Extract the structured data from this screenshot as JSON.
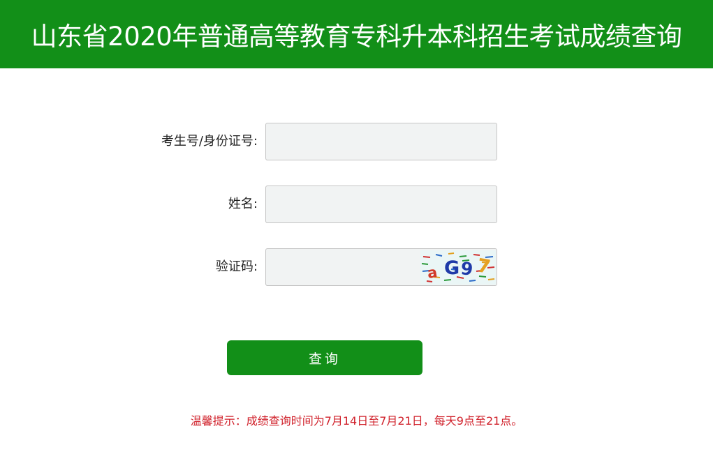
{
  "header": {
    "title": "山东省2020年普通高等教育专科升本科招生考试成绩查询"
  },
  "form": {
    "id_label": "考生号/身份证号:",
    "id_value": "",
    "name_label": "姓名:",
    "name_value": "",
    "captcha_label": "验证码:",
    "captcha_value": "",
    "captcha_text": "aG97"
  },
  "submit_label": "查询",
  "notice": "温馨提示：成绩查询时间为7月14日至7月21日，每天9点至21点。",
  "colors": {
    "brand_green": "#128f18",
    "notice_red": "#d0202a",
    "input_bg": "#f1f3f3"
  }
}
